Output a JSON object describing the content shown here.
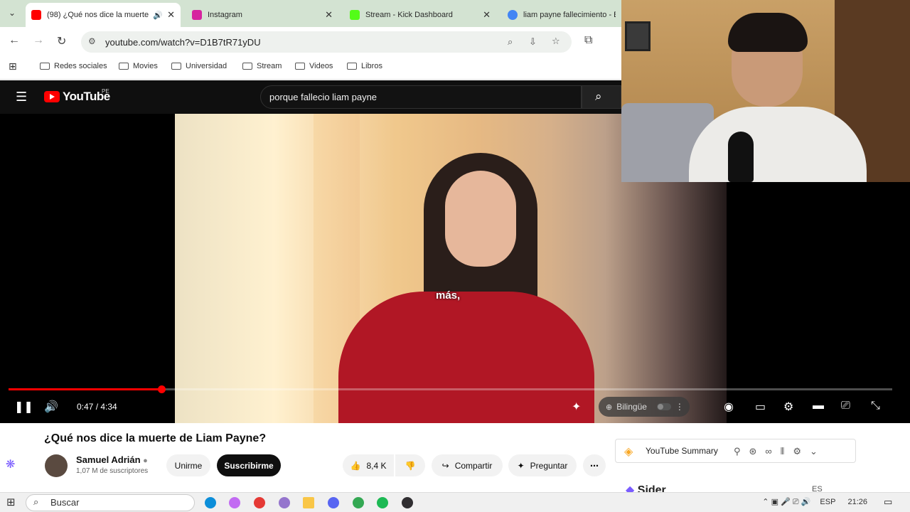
{
  "browser": {
    "tabs": [
      {
        "title": "(98) ¿Qué nos dice la muerte",
        "favicon_color": "#ff0000",
        "active": true
      },
      {
        "title": "Instagram",
        "favicon_color": "#d6249f",
        "active": false
      },
      {
        "title": "Stream - Kick Dashboard",
        "favicon_color": "#53fc18",
        "active": false
      },
      {
        "title": "liam payne fallecimiento - B",
        "favicon_color": "#4285f4",
        "active": false
      }
    ],
    "url": "youtube.com/watch?v=D1B7tR71yDU",
    "bookmarks": [
      "Redes sociales",
      "Movies",
      "Universidad",
      "Stream",
      "Videos",
      "Libros"
    ]
  },
  "youtube": {
    "logo_text": "YouTube",
    "region": "PE",
    "search_query": "porque fallecio liam payne",
    "player": {
      "caption": "más,",
      "time": "0:47 / 4:34",
      "progress_fraction": 0.173,
      "bilingual_label": "Bilingüe"
    },
    "video_title": "¿Qué nos dice la muerte de Liam Payne?",
    "channel": {
      "name": "Samuel Adrián",
      "subscribers": "1,07 M de suscriptores"
    },
    "join_label": "Unirme",
    "subscribe_label": "Suscribirme",
    "like_count": "8,4 K",
    "share_label": "Compartir",
    "ask_label": "Preguntar",
    "extension": {
      "summary_label": "YouTube Summary",
      "sider_label": "Sider",
      "lang": "ES"
    }
  },
  "taskbar": {
    "search_placeholder": "Buscar",
    "lang": "ESP",
    "time": "21:26"
  },
  "colors": {
    "youtube_red": "#ff0000",
    "yt_dark": "#0f0f0f"
  }
}
